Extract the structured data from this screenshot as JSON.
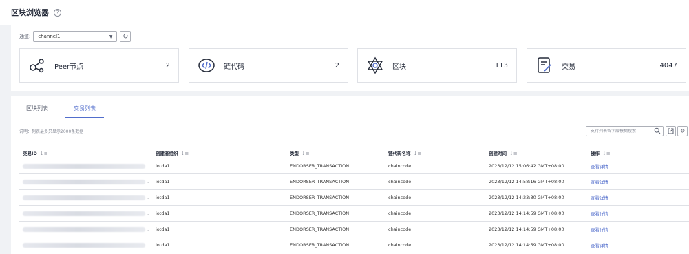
{
  "header": {
    "title": "区块浏览器",
    "help_icon": "question-circle-icon"
  },
  "channel": {
    "label": "通道:",
    "selected": "channel1",
    "refresh_icon": "refresh-icon"
  },
  "stats": [
    {
      "label": "Peer节点",
      "value": "2",
      "icon": "peer-node-icon"
    },
    {
      "label": "链代码",
      "value": "2",
      "icon": "chaincode-icon"
    },
    {
      "label": "区块",
      "value": "113",
      "icon": "block-icon"
    },
    {
      "label": "交易",
      "value": "4047",
      "icon": "transaction-icon"
    }
  ],
  "tabs": [
    {
      "label": "区块列表",
      "active": false
    },
    {
      "label": "交易列表",
      "active": true
    }
  ],
  "note": "说明：列表最多只显示2000条数据",
  "search": {
    "placeholder": "支持列表各字段模糊搜索"
  },
  "table": {
    "headers": [
      "交易ID",
      "创建者组织",
      "类型",
      "链代码名称",
      "创建时间",
      "操作"
    ],
    "rows": [
      {
        "org": "iotda1",
        "type": "ENDORSER_TRANSACTION",
        "chaincode": "chaincode",
        "time": "2023/12/12 15:06:42 GMT+08:00",
        "action": "查看详情"
      },
      {
        "org": "iotda1",
        "type": "ENDORSER_TRANSACTION",
        "chaincode": "chaincode",
        "time": "2023/12/12 14:58:16 GMT+08:00",
        "action": "查看详情"
      },
      {
        "org": "iotda1",
        "type": "ENDORSER_TRANSACTION",
        "chaincode": "chaincode",
        "time": "2023/12/12 14:23:30 GMT+08:00",
        "action": "查看详情"
      },
      {
        "org": "iotda1",
        "type": "ENDORSER_TRANSACTION",
        "chaincode": "chaincode",
        "time": "2023/12/12 14:14:59 GMT+08:00",
        "action": "查看详情"
      },
      {
        "org": "iotda1",
        "type": "ENDORSER_TRANSACTION",
        "chaincode": "chaincode",
        "time": "2023/12/12 14:14:59 GMT+08:00",
        "action": "查看详情"
      },
      {
        "org": "iotda1",
        "type": "ENDORSER_TRANSACTION",
        "chaincode": "chaincode",
        "time": "2023/12/12 14:14:59 GMT+08:00",
        "action": "查看详情"
      }
    ]
  },
  "colors": {
    "accent": "#526ecc",
    "border": "#dfe1e6",
    "background": "#f0f2f5"
  }
}
